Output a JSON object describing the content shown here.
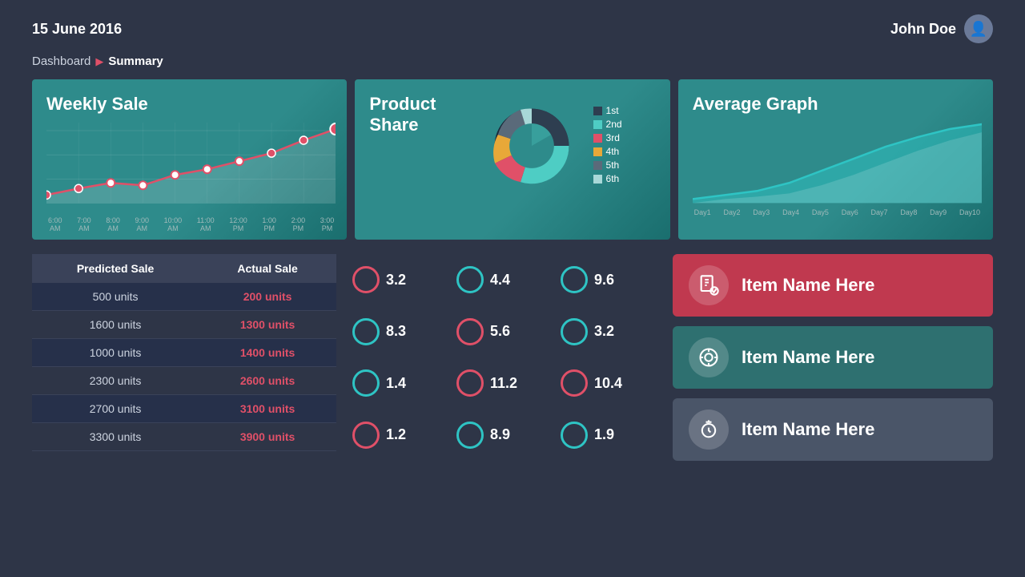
{
  "header": {
    "date": "15 June 2016",
    "username": "John Doe"
  },
  "breadcrumb": {
    "root": "Dashboard",
    "current": "Summary"
  },
  "charts": {
    "weekly_sale": {
      "title": "Weekly Sale",
      "x_labels": [
        "6:00\nAM",
        "7:00\nAM",
        "8:00\nAM",
        "9:00\nAM",
        "10:00\nAM",
        "11:00\nAM",
        "12:00\nPM",
        "1:00\nPM",
        "2:00\nPM",
        "3:00\nPM"
      ]
    },
    "product_share": {
      "title1": "Product",
      "title2": "Share",
      "legend": [
        {
          "label": "1st",
          "color": "#2e3e50"
        },
        {
          "label": "2nd",
          "color": "#4ecdc4"
        },
        {
          "label": "3rd",
          "color": "#e05068"
        },
        {
          "label": "4th",
          "color": "#e8a838"
        },
        {
          "label": "5th",
          "color": "#5a6a7a"
        },
        {
          "label": "6th",
          "color": "#a8d8d8"
        }
      ]
    },
    "average_graph": {
      "title": "Average Graph",
      "x_labels": [
        "Day1",
        "Day2",
        "Day3",
        "Day4",
        "Day5",
        "Day6",
        "Day7",
        "Day8",
        "Day9",
        "Day10"
      ]
    }
  },
  "table": {
    "col1": "Predicted  Sale",
    "col2": "Actual  Sale",
    "rows": [
      {
        "predicted": "500 units",
        "actual": "200 units"
      },
      {
        "predicted": "1600 units",
        "actual": "1300 units"
      },
      {
        "predicted": "1000 units",
        "actual": "1400 units"
      },
      {
        "predicted": "2300 units",
        "actual": "2600 units"
      },
      {
        "predicted": "2700 units",
        "actual": "3100 units"
      },
      {
        "predicted": "3300 units",
        "actual": "3900 units"
      }
    ]
  },
  "metrics": [
    {
      "value": "3.2",
      "type": "pink"
    },
    {
      "value": "4.4",
      "type": "teal"
    },
    {
      "value": "9.6",
      "type": "teal"
    },
    {
      "value": "8.3",
      "type": "teal"
    },
    {
      "value": "5.6",
      "type": "pink"
    },
    {
      "value": "3.2",
      "type": "teal"
    },
    {
      "value": "1.4",
      "type": "teal"
    },
    {
      "value": "11.2",
      "type": "pink"
    },
    {
      "value": "10.4",
      "type": "pink"
    },
    {
      "value": "1.2",
      "type": "pink"
    },
    {
      "value": "8.9",
      "type": "teal"
    },
    {
      "value": "1.9",
      "type": "teal"
    }
  ],
  "actions": [
    {
      "label": "Item Name Here",
      "style": "red",
      "icon": "📋"
    },
    {
      "label": "Item Name Here",
      "style": "teal",
      "icon": "⚖️"
    },
    {
      "label": "Item Name Here",
      "style": "gray",
      "icon": "⏰"
    }
  ]
}
